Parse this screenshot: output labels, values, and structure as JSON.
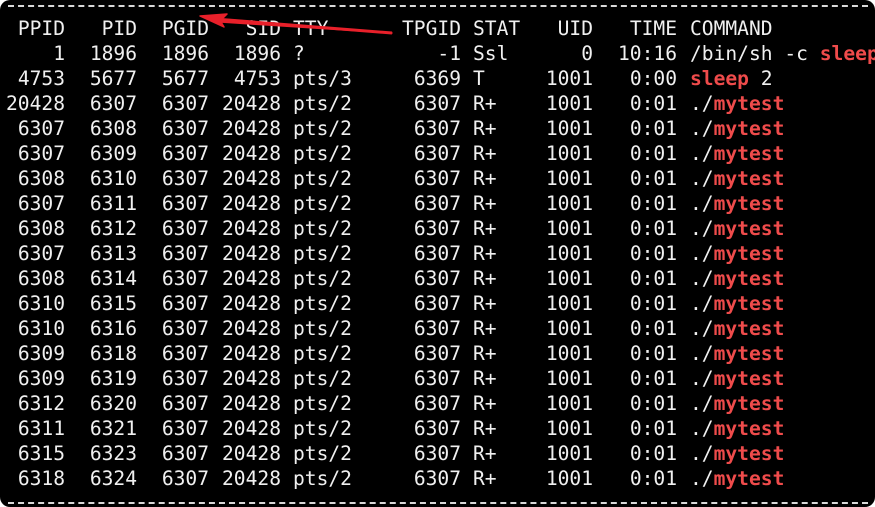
{
  "header": {
    "ppid": "PPID",
    "pid": "PID",
    "pgid": "PGID",
    "sid": "SID",
    "tty": "TTY",
    "tpgid": "TPGID",
    "stat": "STAT",
    "uid": "UID",
    "time": "TIME",
    "command": "COMMAND"
  },
  "rows": [
    {
      "ppid": "1",
      "pid": "1896",
      "pgid": "1896",
      "sid": "1896",
      "tty": "?",
      "tpgid": "-1",
      "stat": "Ssl",
      "uid": "0",
      "time": "10:16",
      "cmd_plain": "/bin/sh -c ",
      "cmd_hl": "sleep",
      "cmd_tail": ""
    },
    {
      "ppid": "4753",
      "pid": "5677",
      "pgid": "5677",
      "sid": "4753",
      "tty": "pts/3",
      "tpgid": "6369",
      "stat": "T",
      "uid": "1001",
      "time": "0:00",
      "cmd_plain": "",
      "cmd_hl": "sleep",
      "cmd_tail": " 2"
    },
    {
      "ppid": "20428",
      "pid": "6307",
      "pgid": "6307",
      "sid": "20428",
      "tty": "pts/2",
      "tpgid": "6307",
      "stat": "R+",
      "uid": "1001",
      "time": "0:01",
      "cmd_plain": "./",
      "cmd_hl": "mytest",
      "cmd_tail": ""
    },
    {
      "ppid": "6307",
      "pid": "6308",
      "pgid": "6307",
      "sid": "20428",
      "tty": "pts/2",
      "tpgid": "6307",
      "stat": "R+",
      "uid": "1001",
      "time": "0:01",
      "cmd_plain": "./",
      "cmd_hl": "mytest",
      "cmd_tail": ""
    },
    {
      "ppid": "6307",
      "pid": "6309",
      "pgid": "6307",
      "sid": "20428",
      "tty": "pts/2",
      "tpgid": "6307",
      "stat": "R+",
      "uid": "1001",
      "time": "0:01",
      "cmd_plain": "./",
      "cmd_hl": "mytest",
      "cmd_tail": ""
    },
    {
      "ppid": "6308",
      "pid": "6310",
      "pgid": "6307",
      "sid": "20428",
      "tty": "pts/2",
      "tpgid": "6307",
      "stat": "R+",
      "uid": "1001",
      "time": "0:01",
      "cmd_plain": "./",
      "cmd_hl": "mytest",
      "cmd_tail": ""
    },
    {
      "ppid": "6307",
      "pid": "6311",
      "pgid": "6307",
      "sid": "20428",
      "tty": "pts/2",
      "tpgid": "6307",
      "stat": "R+",
      "uid": "1001",
      "time": "0:01",
      "cmd_plain": "./",
      "cmd_hl": "mytest",
      "cmd_tail": ""
    },
    {
      "ppid": "6308",
      "pid": "6312",
      "pgid": "6307",
      "sid": "20428",
      "tty": "pts/2",
      "tpgid": "6307",
      "stat": "R+",
      "uid": "1001",
      "time": "0:01",
      "cmd_plain": "./",
      "cmd_hl": "mytest",
      "cmd_tail": ""
    },
    {
      "ppid": "6307",
      "pid": "6313",
      "pgid": "6307",
      "sid": "20428",
      "tty": "pts/2",
      "tpgid": "6307",
      "stat": "R+",
      "uid": "1001",
      "time": "0:01",
      "cmd_plain": "./",
      "cmd_hl": "mytest",
      "cmd_tail": ""
    },
    {
      "ppid": "6308",
      "pid": "6314",
      "pgid": "6307",
      "sid": "20428",
      "tty": "pts/2",
      "tpgid": "6307",
      "stat": "R+",
      "uid": "1001",
      "time": "0:01",
      "cmd_plain": "./",
      "cmd_hl": "mytest",
      "cmd_tail": ""
    },
    {
      "ppid": "6310",
      "pid": "6315",
      "pgid": "6307",
      "sid": "20428",
      "tty": "pts/2",
      "tpgid": "6307",
      "stat": "R+",
      "uid": "1001",
      "time": "0:01",
      "cmd_plain": "./",
      "cmd_hl": "mytest",
      "cmd_tail": ""
    },
    {
      "ppid": "6310",
      "pid": "6316",
      "pgid": "6307",
      "sid": "20428",
      "tty": "pts/2",
      "tpgid": "6307",
      "stat": "R+",
      "uid": "1001",
      "time": "0:01",
      "cmd_plain": "./",
      "cmd_hl": "mytest",
      "cmd_tail": ""
    },
    {
      "ppid": "6309",
      "pid": "6318",
      "pgid": "6307",
      "sid": "20428",
      "tty": "pts/2",
      "tpgid": "6307",
      "stat": "R+",
      "uid": "1001",
      "time": "0:01",
      "cmd_plain": "./",
      "cmd_hl": "mytest",
      "cmd_tail": ""
    },
    {
      "ppid": "6309",
      "pid": "6319",
      "pgid": "6307",
      "sid": "20428",
      "tty": "pts/2",
      "tpgid": "6307",
      "stat": "R+",
      "uid": "1001",
      "time": "0:01",
      "cmd_plain": "./",
      "cmd_hl": "mytest",
      "cmd_tail": ""
    },
    {
      "ppid": "6312",
      "pid": "6320",
      "pgid": "6307",
      "sid": "20428",
      "tty": "pts/2",
      "tpgid": "6307",
      "stat": "R+",
      "uid": "1001",
      "time": "0:01",
      "cmd_plain": "./",
      "cmd_hl": "mytest",
      "cmd_tail": ""
    },
    {
      "ppid": "6311",
      "pid": "6321",
      "pgid": "6307",
      "sid": "20428",
      "tty": "pts/2",
      "tpgid": "6307",
      "stat": "R+",
      "uid": "1001",
      "time": "0:01",
      "cmd_plain": "./",
      "cmd_hl": "mytest",
      "cmd_tail": ""
    },
    {
      "ppid": "6315",
      "pid": "6323",
      "pgid": "6307",
      "sid": "20428",
      "tty": "pts/2",
      "tpgid": "6307",
      "stat": "R+",
      "uid": "1001",
      "time": "0:01",
      "cmd_plain": "./",
      "cmd_hl": "mytest",
      "cmd_tail": ""
    },
    {
      "ppid": "6318",
      "pid": "6324",
      "pgid": "6307",
      "sid": "20428",
      "tty": "pts/2",
      "tpgid": "6307",
      "stat": "R+",
      "uid": "1001",
      "time": "0:01",
      "cmd_plain": "./",
      "cmd_hl": "mytest",
      "cmd_tail": ""
    }
  ],
  "colors": {
    "background": "#000000",
    "text": "#f0f0f0",
    "highlight": "#ef4b4b",
    "annotation_arrow": "#e8202a"
  },
  "annotation": {
    "icon": "red-arrow-icon",
    "points_to": "PGID"
  }
}
